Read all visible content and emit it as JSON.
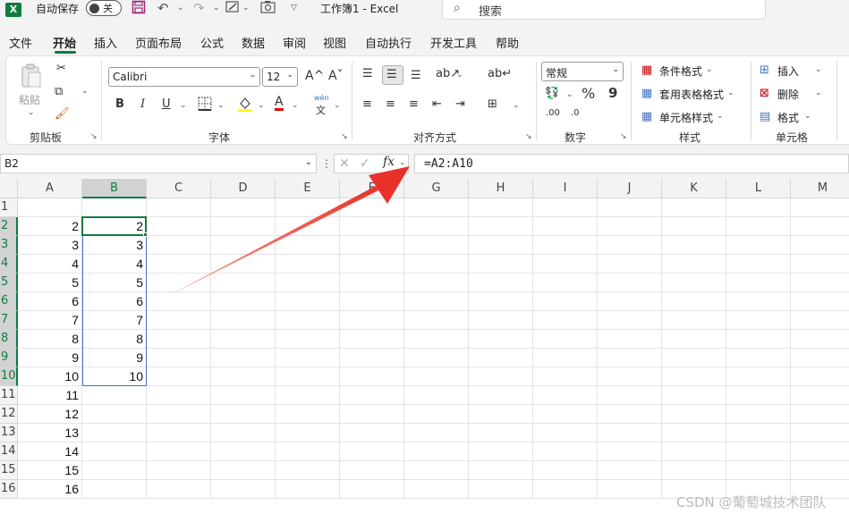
{
  "title_bar": {
    "app_icon": "X",
    "autosave_label": "自动保存",
    "autosave_state": "关",
    "document_title": "工作簿1  -  Excel",
    "search_placeholder": "搜索",
    "icons": [
      "excel-logo-icon",
      "save-icon",
      "undo-icon",
      "redo-icon",
      "format-painter-icon",
      "camera-icon",
      "customize-qat-icon",
      "search-icon"
    ]
  },
  "tabs": [
    "文件",
    "开始",
    "插入",
    "页面布局",
    "公式",
    "数据",
    "审阅",
    "视图",
    "自动执行",
    "开发工具",
    "帮助"
  ],
  "active_tab": "开始",
  "ribbon": {
    "clipboard": {
      "paste": "粘贴",
      "group": "剪贴板"
    },
    "font": {
      "name": "Calibri",
      "size": "12",
      "group": "字体",
      "bold": "B",
      "italic": "I",
      "underline": "U",
      "grow": "A^",
      "shrink": "Aˇ",
      "font_color": "A",
      "phonetic_top": "wén",
      "phonetic_bottom": "文"
    },
    "alignment": {
      "group": "对齐方式"
    },
    "number": {
      "format": "常规",
      "group": "数字",
      "percent": "%",
      "comma": "9",
      "inc_decimal": ".00",
      "dec_decimal": ".0"
    },
    "styles": {
      "conditional": "条件格式",
      "table": "套用表格格式",
      "cell_styles": "单元格样式",
      "group": "样式"
    },
    "cells": {
      "insert": "插入",
      "delete": "删除",
      "format": "格式",
      "group": "单元格"
    }
  },
  "formula_bar": {
    "name_box": "B2",
    "fx": "fx",
    "formula": "=A2:A10"
  },
  "columns": [
    "A",
    "B",
    "C",
    "D",
    "E",
    "F",
    "G",
    "H",
    "I",
    "J",
    "K",
    "L",
    "M"
  ],
  "rows": [
    "1",
    "2",
    "3",
    "4",
    "5",
    "6",
    "7",
    "8",
    "9",
    "10",
    "11",
    "12",
    "13",
    "14",
    "15",
    "16"
  ],
  "cells": {
    "A": [
      "",
      "2",
      "3",
      "4",
      "5",
      "6",
      "7",
      "8",
      "9",
      "10",
      "11",
      "12",
      "13",
      "14",
      "15",
      "16"
    ],
    "B": [
      "",
      "2",
      "3",
      "4",
      "5",
      "6",
      "7",
      "8",
      "9",
      "10",
      "",
      "",
      "",
      "",
      "",
      ""
    ]
  },
  "selection": {
    "active_cell": "B2",
    "range": "B2:B10"
  },
  "annotation": {
    "arrow_color": "#e8312a",
    "points_to": "formula-input"
  },
  "watermark": "CSDN @葡萄城技术团队",
  "colors": {
    "accent": "#107c41",
    "selection_border": "#4472c4"
  }
}
